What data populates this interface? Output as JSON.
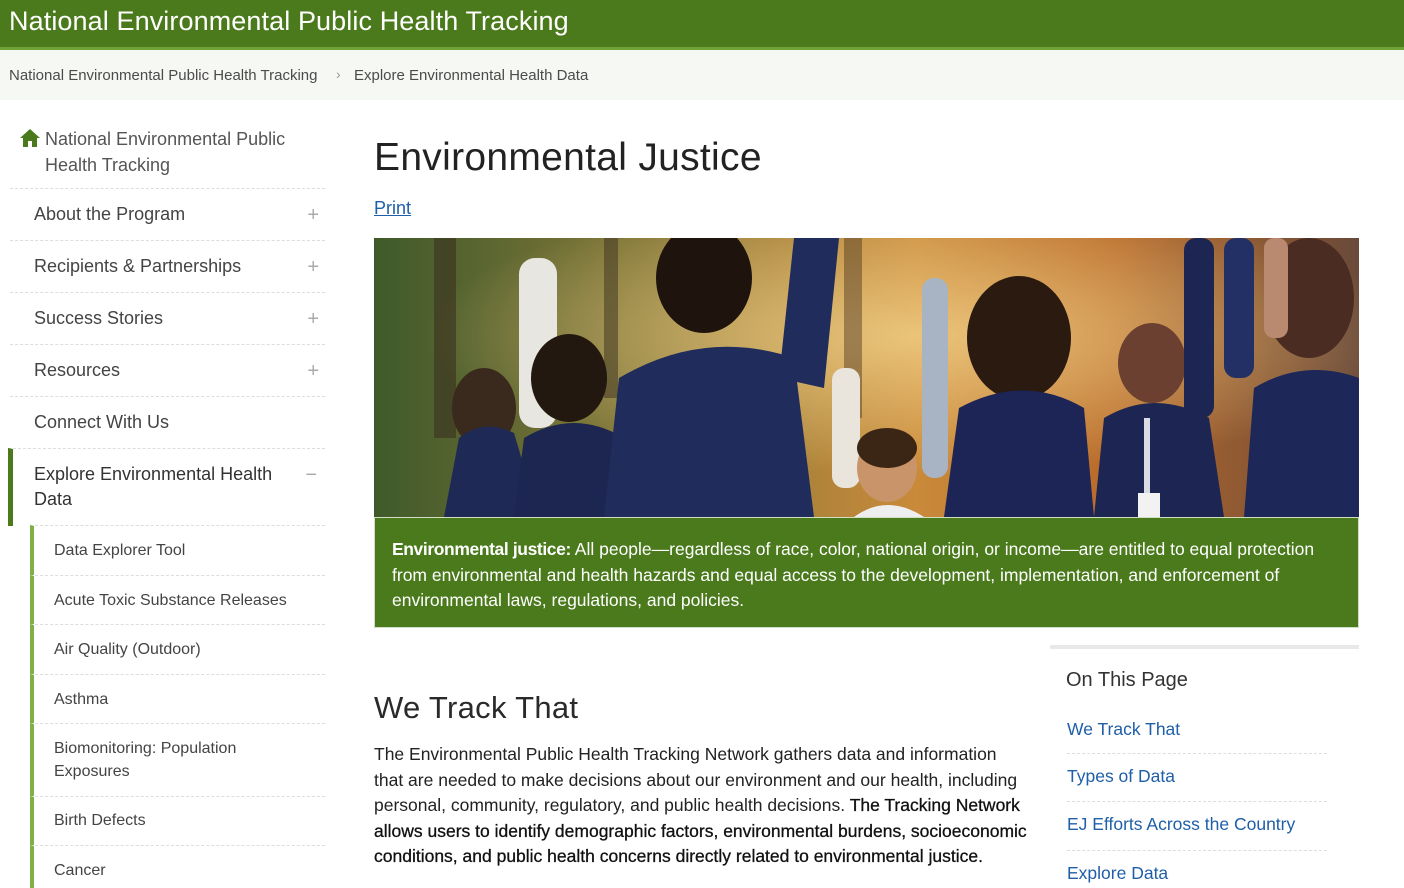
{
  "header": {
    "site_title": "National Environmental Public Health Tracking"
  },
  "breadcrumb": {
    "items": [
      "National Environmental Public Health Tracking",
      "Explore Environmental Health Data"
    ],
    "separator": "›"
  },
  "sidebar": {
    "home_label": "National Environmental Public Health Tracking",
    "items": [
      {
        "label": "About the Program",
        "expander": "+"
      },
      {
        "label": "Recipients & Partnerships",
        "expander": "+"
      },
      {
        "label": "Success Stories",
        "expander": "+"
      },
      {
        "label": "Resources",
        "expander": "+"
      },
      {
        "label": "Connect With Us"
      },
      {
        "label": "Explore Environmental Health Data",
        "expander": "−"
      }
    ],
    "sub_items": [
      {
        "label": "Data Explorer Tool"
      },
      {
        "label": "Acute Toxic Substance Releases"
      },
      {
        "label": "Air Quality (Outdoor)"
      },
      {
        "label": "Asthma"
      },
      {
        "label": "Biomonitoring: Population Exposures"
      },
      {
        "label": "Birth Defects"
      },
      {
        "label": "Cancer"
      }
    ]
  },
  "main": {
    "title": "Environmental Justice",
    "print_label": "Print",
    "callout": {
      "term": "Environmental justice:",
      "text": " All people—regardless of race, color, national origin, or income—are entitled to equal protection from environmental and health hazards and equal access to the development, implementation, and enforcement of environmental laws, regulations, and policies."
    },
    "section_title": "We Track That",
    "body_regular": "The Environmental Public Health Tracking Network gathers data and information that are needed to make decisions about our environment and our health, including personal, community, regulatory, and public health decisions. ",
    "body_bold": "The Tracking Network allows users to identify demographic factors, environmental burdens, socioeconomic conditions, and public health concerns directly related to environmental justice."
  },
  "on_this_page": {
    "title": "On This Page",
    "links": [
      "We Track That",
      "Types of Data",
      "EJ Efforts Across the Country",
      "Explore Data"
    ]
  },
  "colors": {
    "brand_green": "#4a7a1b",
    "accent_green": "#6fa336",
    "link_blue": "#1f5ea8"
  }
}
